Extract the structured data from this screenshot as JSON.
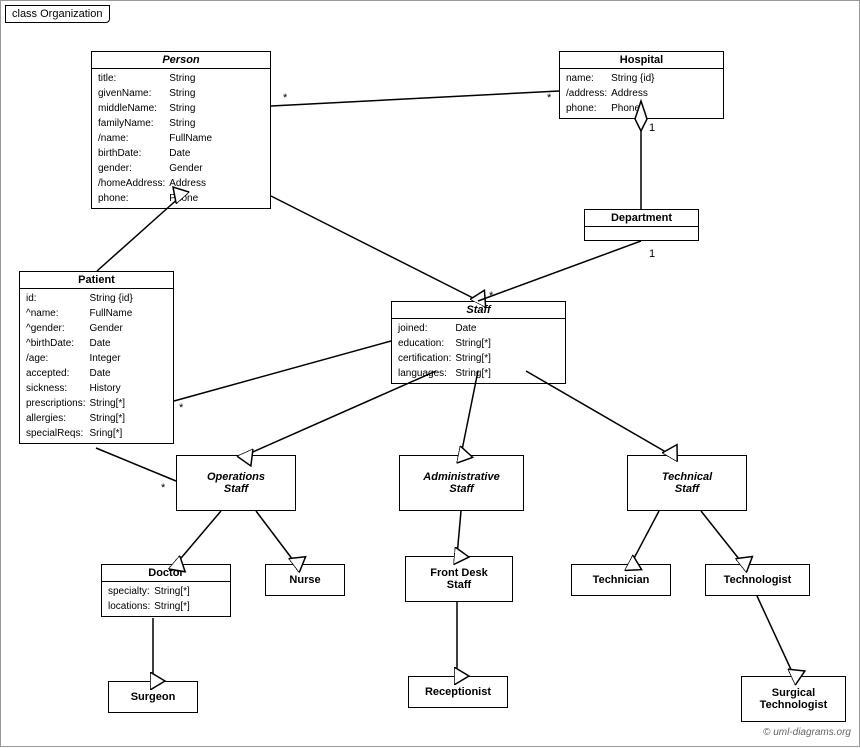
{
  "diagram": {
    "title": "class Organization",
    "watermark": "© uml-diagrams.org",
    "classes": {
      "person": {
        "name": "Person",
        "italic": true,
        "fields": [
          {
            "name": "title:",
            "type": "String"
          },
          {
            "name": "givenName:",
            "type": "String"
          },
          {
            "name": "middleName:",
            "type": "String"
          },
          {
            "name": "familyName:",
            "type": "String"
          },
          {
            "name": "/name:",
            "type": "FullName"
          },
          {
            "name": "birthDate:",
            "type": "Date"
          },
          {
            "name": "gender:",
            "type": "Gender"
          },
          {
            "name": "/homeAddress:",
            "type": "Address"
          },
          {
            "name": "phone:",
            "type": "Phone"
          }
        ]
      },
      "hospital": {
        "name": "Hospital",
        "fields": [
          {
            "name": "name:",
            "type": "String {id}"
          },
          {
            "name": "/address:",
            "type": "Address"
          },
          {
            "name": "phone:",
            "type": "Phone"
          }
        ]
      },
      "department": {
        "name": "Department",
        "fields": []
      },
      "staff": {
        "name": "Staff",
        "italic": true,
        "fields": [
          {
            "name": "joined:",
            "type": "Date"
          },
          {
            "name": "education:",
            "type": "String[*]"
          },
          {
            "name": "certification:",
            "type": "String[*]"
          },
          {
            "name": "languages:",
            "type": "String[*]"
          }
        ]
      },
      "patient": {
        "name": "Patient",
        "fields": [
          {
            "name": "id:",
            "type": "String {id}"
          },
          {
            "name": "^name:",
            "type": "FullName"
          },
          {
            "name": "^gender:",
            "type": "Gender"
          },
          {
            "name": "^birthDate:",
            "type": "Date"
          },
          {
            "name": "/age:",
            "type": "Integer"
          },
          {
            "name": "accepted:",
            "type": "Date"
          },
          {
            "name": "sickness:",
            "type": "History"
          },
          {
            "name": "prescriptions:",
            "type": "String[*]"
          },
          {
            "name": "allergies:",
            "type": "String[*]"
          },
          {
            "name": "specialReqs:",
            "type": "Sring[*]"
          }
        ]
      },
      "operationsStaff": {
        "name": "Operations Staff",
        "italic": true,
        "fields": []
      },
      "administrativeStaff": {
        "name": "Administrative Staff",
        "italic": true,
        "fields": []
      },
      "technicalStaff": {
        "name": "Technical Staff",
        "italic": true,
        "fields": []
      },
      "doctor": {
        "name": "Doctor",
        "fields": [
          {
            "name": "specialty:",
            "type": "String[*]"
          },
          {
            "name": "locations:",
            "type": "String[*]"
          }
        ]
      },
      "nurse": {
        "name": "Nurse",
        "fields": []
      },
      "frontDeskStaff": {
        "name": "Front Desk Staff",
        "fields": []
      },
      "technician": {
        "name": "Technician",
        "fields": []
      },
      "technologist": {
        "name": "Technologist",
        "fields": []
      },
      "surgeon": {
        "name": "Surgeon",
        "fields": []
      },
      "receptionist": {
        "name": "Receptionist",
        "fields": []
      },
      "surgicalTechnologist": {
        "name": "Surgical Technologist",
        "fields": []
      }
    }
  }
}
